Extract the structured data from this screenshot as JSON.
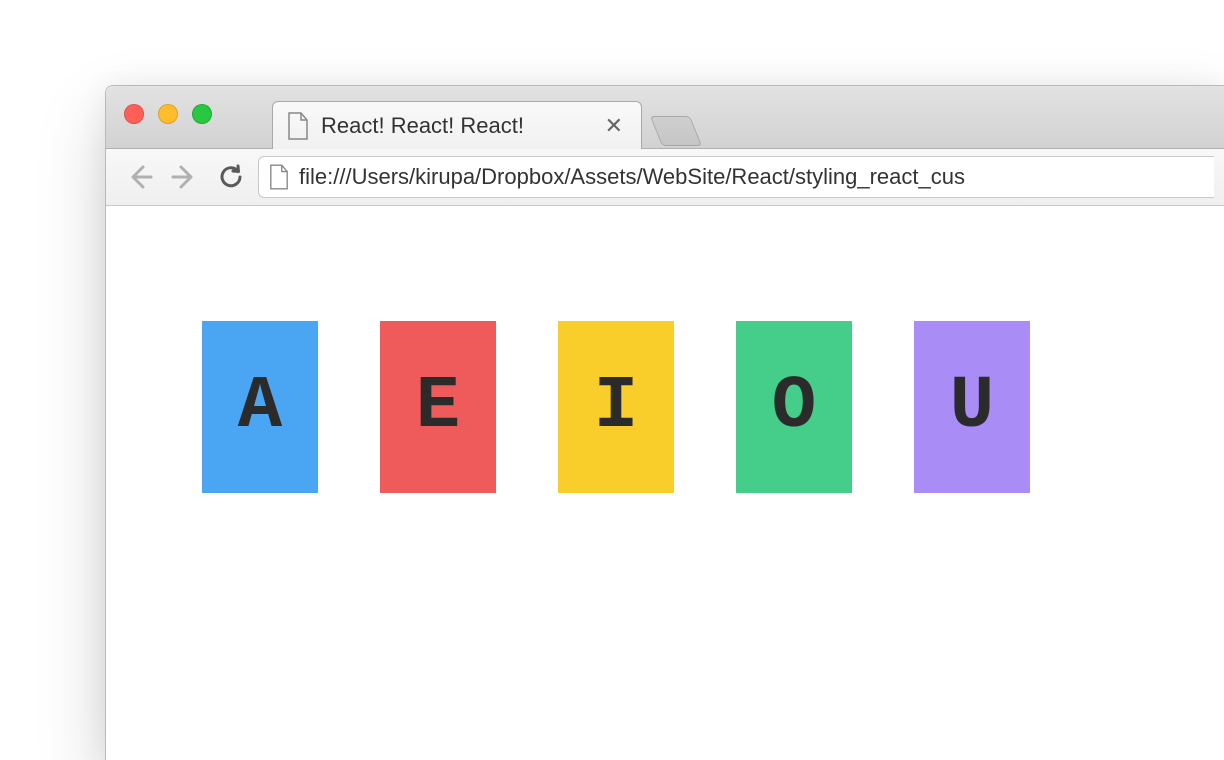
{
  "browser": {
    "tab": {
      "title": "React! React! React!"
    },
    "url": "file:///Users/kirupa/Dropbox/Assets/WebSite/React/styling_react_cus"
  },
  "letters": [
    {
      "char": "A",
      "color": "#4aa5f2"
    },
    {
      "char": "E",
      "color": "#ef5b5b"
    },
    {
      "char": "I",
      "color": "#f9ce2b"
    },
    {
      "char": "O",
      "color": "#45cd8a"
    },
    {
      "char": "U",
      "color": "#a98cf6"
    }
  ]
}
